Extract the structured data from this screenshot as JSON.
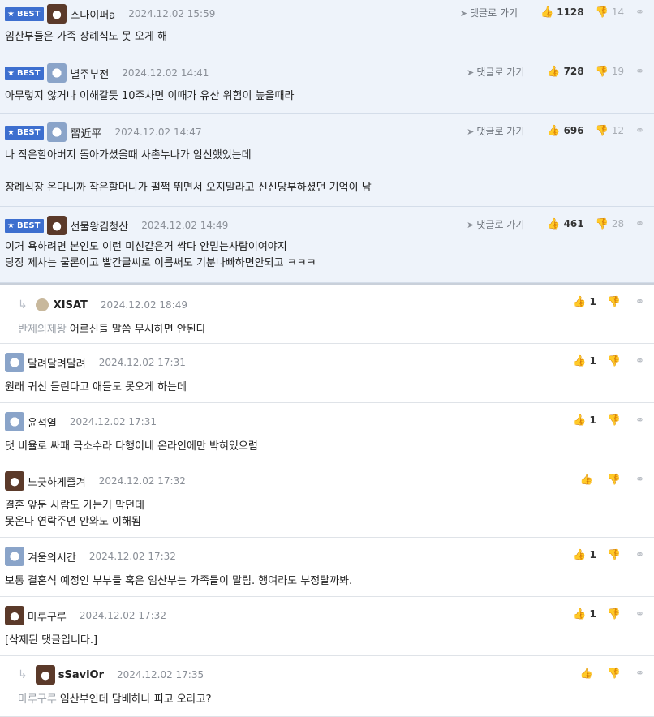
{
  "labels": {
    "best": "BEST",
    "goto": "댓글로 가기"
  },
  "comments": [
    {
      "nick": "스나이퍼a",
      "date": "2024.12.02 15:59",
      "up": "1128",
      "down": "14",
      "text": "임산부들은 가족 장례식도 못 오게 해"
    },
    {
      "nick": "별주부전",
      "date": "2024.12.02 14:41",
      "up": "728",
      "down": "19",
      "text": "아무렇지 않거나 이해갈듯 10주차면 이때가 유산 위험이 높을때라"
    },
    {
      "nick": "習近平",
      "date": "2024.12.02 14:47",
      "up": "696",
      "down": "12",
      "text": "나 작은할아버지 돌아가셨을때 사촌누나가 임신했었는데\n\n장례식장 온다니까 작은할머니가 펄쩍 뛰면서 오지말라고 신신당부하셨던 기억이 남"
    },
    {
      "nick": "선물왕김청산",
      "date": "2024.12.02 14:49",
      "up": "461",
      "down": "28",
      "text": "이거 욕하려면 본인도 이런 미신같은거 싹다 안믿는사람이여야지\n당장 제사는 물론이고 빨간글씨로 이름써도 기분나빠하면안되고 ㅋㅋㅋ"
    },
    {
      "nick": "XISAT",
      "date": "2024.12.02 18:49",
      "up": "1",
      "to": "반제의제왕",
      "text": "어르신들 말씀 무시하면 안된다"
    },
    {
      "nick": "달려달려달려",
      "date": "2024.12.02 17:31",
      "up": "1",
      "text": "원래 귀신 들린다고 애들도 못오게 하는데"
    },
    {
      "nick": "윤석열",
      "date": "2024.12.02 17:31",
      "up": "1",
      "text": "댓 비율로 싸패 극소수라 다행이네 온라인에만 박혀있으렴"
    },
    {
      "nick": "느긋하게즐겨",
      "date": "2024.12.02 17:32",
      "up": "",
      "text": "결혼 앞둔 사람도 가는거 막던데\n못온다 연락주면 안와도 이해됨"
    },
    {
      "nick": "겨울의시간",
      "date": "2024.12.02 17:32",
      "up": "1",
      "text": "보통 결혼식 예정인 부부들 혹은 임산부는 가족들이 말림. 행여라도 부정탈까봐."
    },
    {
      "nick": "마루구루",
      "date": "2024.12.02 17:32",
      "up": "1",
      "text": "[삭제된 댓글입니다.]"
    },
    {
      "nick": "sSaviOr",
      "date": "2024.12.02 17:35",
      "up": "",
      "to": "마루구루",
      "text": "임산부인데 담배하나 피고 오라고?"
    }
  ]
}
